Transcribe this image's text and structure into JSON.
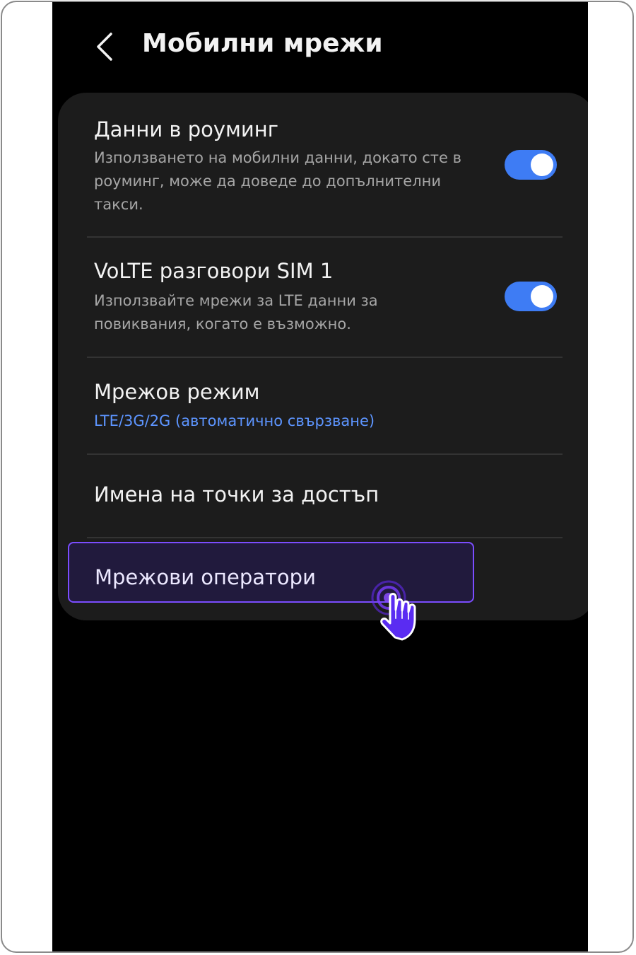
{
  "header": {
    "back_icon": "chevron-left-icon",
    "title": "Мобилни мрежи"
  },
  "settings": [
    {
      "title": "Данни в роуминг",
      "description": "Използването на мобилни данни, докато сте в роуминг, може да доведе до допълнителни такси.",
      "toggle_on": true
    },
    {
      "title": "VoLTE разговори SIM 1",
      "description": "Използвайте мрежи за LTE данни за повиквания, когато е възможно.",
      "toggle_on": true
    },
    {
      "title": "Мрежов режим",
      "value": "LTE/3G/2G (автоматично свързване)"
    },
    {
      "title": "Имена на точки за достъп"
    },
    {
      "title": "Мрежови оператори",
      "highlighted": true
    }
  ],
  "colors": {
    "screen_bg": "#000000",
    "card_bg": "#1c1c1c",
    "toggle_on": "#3e7cf4",
    "value_text": "#5d95ff",
    "highlight_border": "#7b4dff",
    "pointer": "#6a2bff"
  },
  "pointer": {
    "icon": "tap-hand-icon"
  }
}
